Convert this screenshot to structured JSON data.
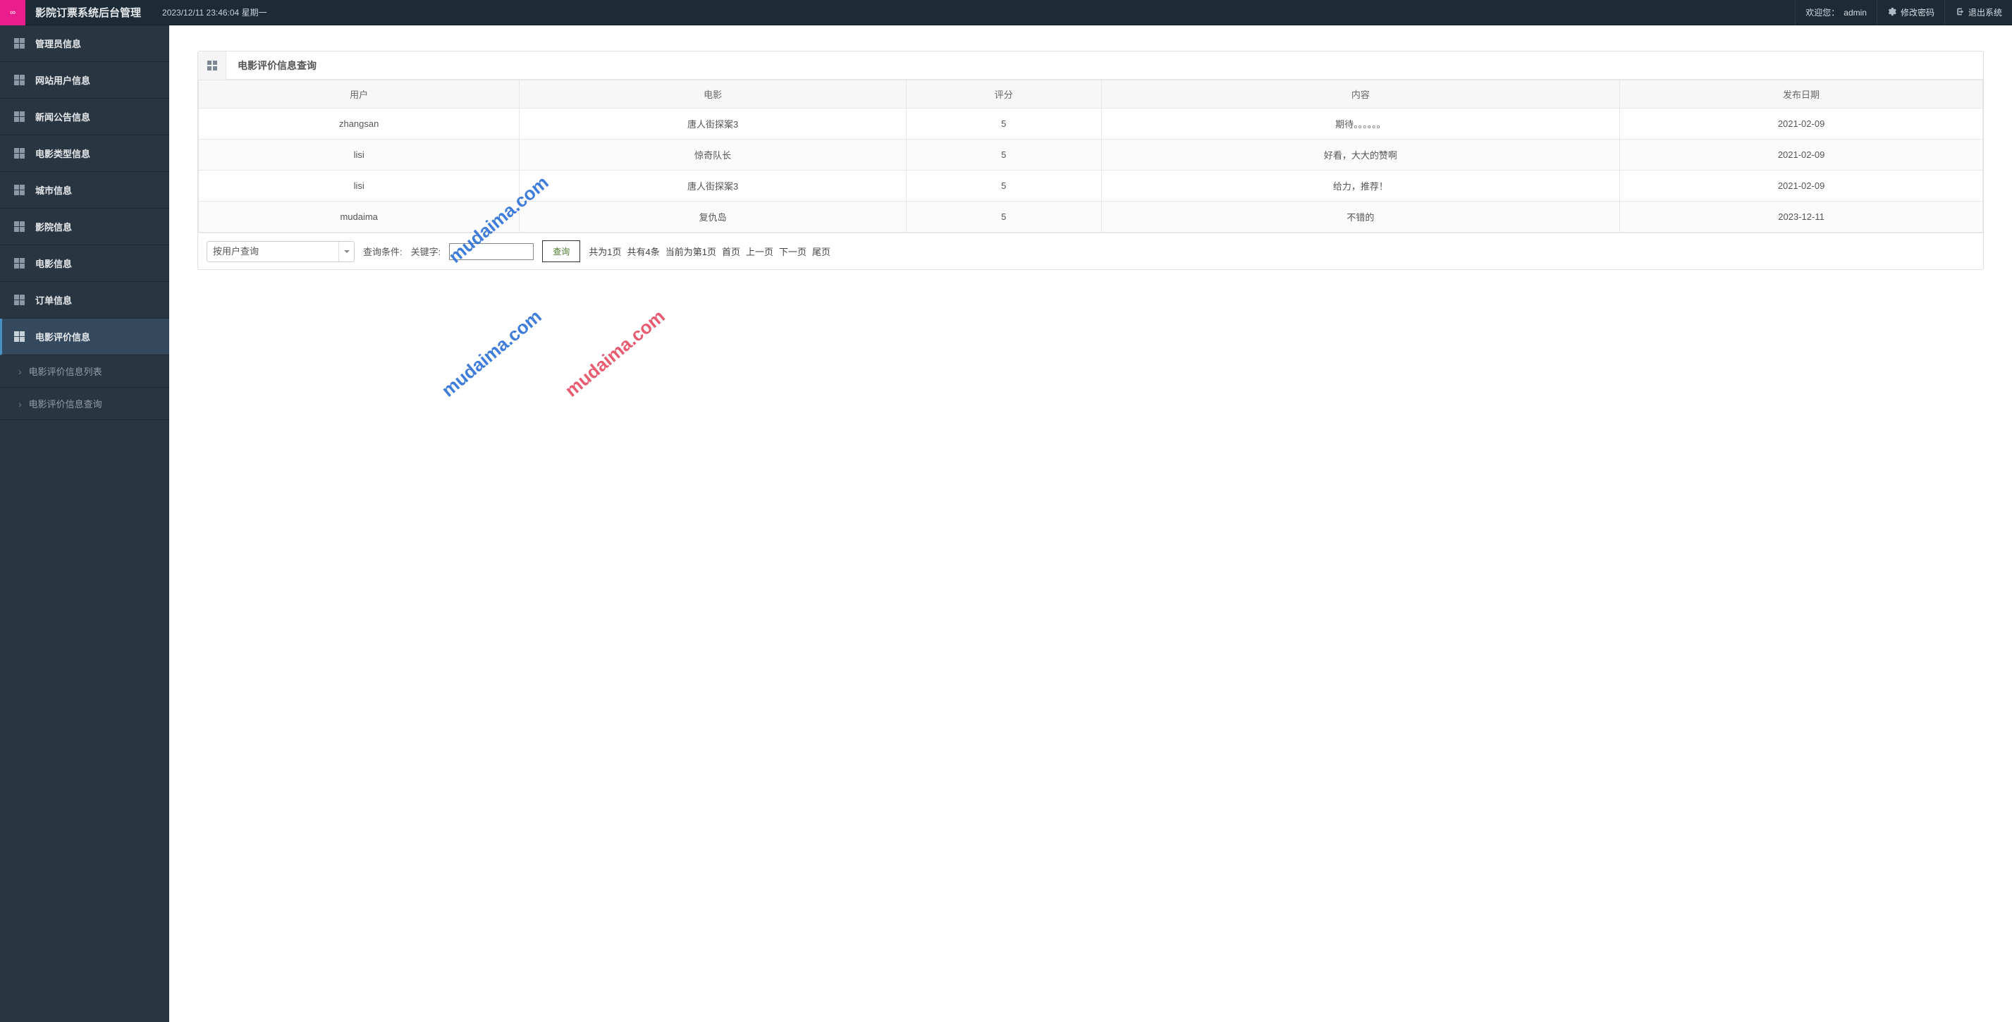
{
  "header": {
    "brand": "影院订票系统后台管理",
    "datetime": "2023/12/11 23:46:04 星期一",
    "welcome_prefix": "欢迎您：",
    "welcome_user": "admin",
    "change_pwd": "修改密码",
    "logout": "退出系统"
  },
  "sidebar": {
    "items": [
      {
        "label": "管理员信息"
      },
      {
        "label": "网站用户信息"
      },
      {
        "label": "新闻公告信息"
      },
      {
        "label": "电影类型信息"
      },
      {
        "label": "城市信息"
      },
      {
        "label": "影院信息"
      },
      {
        "label": "电影信息"
      },
      {
        "label": "订单信息"
      },
      {
        "label": "电影评价信息"
      }
    ],
    "sub": [
      {
        "label": "电影评价信息列表"
      },
      {
        "label": "电影评价信息查询"
      }
    ]
  },
  "panel": {
    "title": "电影评价信息查询"
  },
  "table": {
    "headers": [
      "用户",
      "电影",
      "评分",
      "内容",
      "发布日期"
    ],
    "rows": [
      {
        "user": "zhangsan",
        "movie": "唐人街探案3",
        "score": "5",
        "content": "期待。。。。。。",
        "date": "2021-02-09"
      },
      {
        "user": "lisi",
        "movie": "惊奇队长",
        "score": "5",
        "content": "好看，大大的赞啊",
        "date": "2021-02-09"
      },
      {
        "user": "lisi",
        "movie": "唐人街探案3",
        "score": "5",
        "content": "给力，推荐！",
        "date": "2021-02-09"
      },
      {
        "user": "mudaima",
        "movie": "复仇岛",
        "score": "5",
        "content": "不错的",
        "date": "2023-12-11"
      }
    ]
  },
  "toolbar": {
    "select_value": "按用户查询",
    "cond_label": "查询条件:",
    "keyword_label": "关键字:",
    "keyword_value": "",
    "query_btn": "查询",
    "page_total": "共为1页",
    "record_total": "共有4条",
    "current_page": "当前为第1页",
    "first": "首页",
    "prev": "上一页",
    "next": "下一页",
    "last": "尾页"
  },
  "watermark": "mudaima.com"
}
